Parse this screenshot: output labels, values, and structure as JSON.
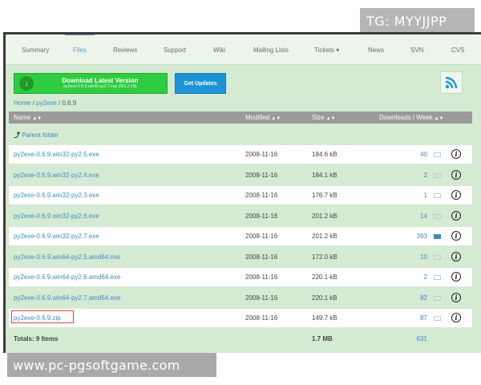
{
  "watermark_top": "TG: MYYJJPP",
  "watermark_bottom": "www.pc-pgsoftgame.com",
  "nav": [
    "Summary",
    "Files",
    "Reviews",
    "Support",
    "Wiki",
    "Mailing Lists",
    "Tickets ▾",
    "News",
    "SVN",
    "CVS"
  ],
  "nav_active": "Files",
  "download": {
    "title": "Download Latest Version",
    "subtitle": "py2exe-0.6.9.win32-py2.7.exe (301.2 kB)",
    "update_label": "Get Updates"
  },
  "breadcrumb": {
    "home": "Home",
    "sep1": " / ",
    "project": "py2exe",
    "sep2": " / ",
    "current": "0.6.9"
  },
  "table": {
    "headers": {
      "name": "Name",
      "modified": "Modified",
      "size": "Size",
      "downloads": "Downloads / Week"
    },
    "parent_label": "Parent folder",
    "rows": [
      {
        "name": "py2exe-0.6.9.win32-py2.5.exe",
        "modified": "2008-11-16",
        "size": "184.6 kB",
        "downloads": "40"
      },
      {
        "name": "py2exe-0.6.9.win32-py2.4.exe",
        "modified": "2008-11-16",
        "size": "184.1 kB",
        "downloads": "2"
      },
      {
        "name": "py2exe-0.6.9.win32-py2.3.exe",
        "modified": "2008-11-16",
        "size": "176.7 kB",
        "downloads": "1"
      },
      {
        "name": "py2exe-0.6.9.win32-py2.6.exe",
        "modified": "2008-11-16",
        "size": "201.2 kB",
        "downloads": "14"
      },
      {
        "name": "py2exe-0.6.9.win32-py2.7.exe",
        "modified": "2008-11-16",
        "size": "201.2 kB",
        "downloads": "393"
      },
      {
        "name": "py2exe-0.6.9.win64-py2.5.amd64.msi",
        "modified": "2008-11-16",
        "size": "172.0 kB",
        "downloads": "10"
      },
      {
        "name": "py2exe-0.6.9.win64-py2.6.amd64.exe",
        "modified": "2008-11-16",
        "size": "220.1 kB",
        "downloads": "2"
      },
      {
        "name": "py2exe-0.6.9.win64-py2.7.amd64.exe",
        "modified": "2008-11-16",
        "size": "220.1 kB",
        "downloads": "82"
      },
      {
        "name": "py2exe-0.6.9.zip",
        "modified": "2008-11-16",
        "size": "149.7 kB",
        "downloads": "87"
      }
    ],
    "totals": {
      "label": "Totals: 9 Items",
      "size": "1.7 MB",
      "downloads": "631"
    }
  },
  "colors": {
    "accent_green": "#2ecc40",
    "accent_blue": "#1e93d4",
    "link": "#3a8dc0",
    "row_alt": "#d4ead3",
    "highlight": "#d94444"
  }
}
